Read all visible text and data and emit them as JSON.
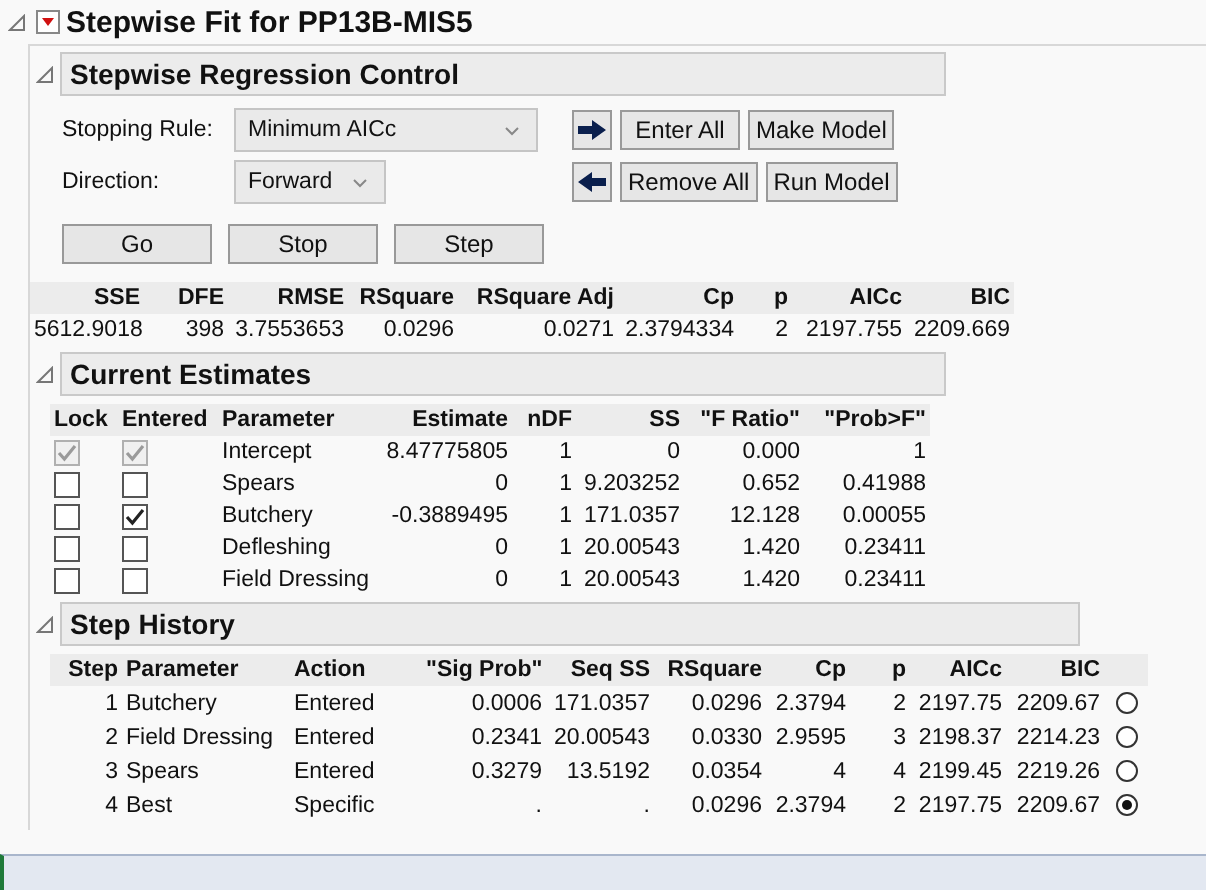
{
  "report": {
    "title": "Stepwise Fit for PP13B-MIS5",
    "expanded": true
  },
  "control": {
    "title": "Stepwise Regression Control",
    "expanded": true,
    "stopping_rule": {
      "label": "Stopping Rule:",
      "value": "Minimum AICc"
    },
    "direction": {
      "label": "Direction:",
      "value": "Forward"
    },
    "run_buttons": [
      "Go",
      "Stop",
      "Step"
    ],
    "enter_buttons": [
      "Enter All",
      "Make Model"
    ],
    "remove_buttons": [
      "Remove All",
      "Run Model"
    ]
  },
  "summary": {
    "columns": [
      "SSE",
      "DFE",
      "RMSE",
      "RSquare",
      "RSquare Adj",
      "Cp",
      "p",
      "AICc",
      "BIC"
    ],
    "row": [
      "5612.9018",
      "398",
      "3.7553653",
      "0.0296",
      "0.0271",
      "2.3794334",
      "2",
      "2197.755",
      "2209.669"
    ]
  },
  "estimates": {
    "title": "Current Estimates",
    "expanded": true,
    "checkbox_columns": [
      "Lock",
      "Entered"
    ],
    "columns": [
      "Parameter",
      "Estimate",
      "nDF",
      "SS",
      "\"F Ratio\"",
      "\"Prob>F\""
    ],
    "rows": [
      {
        "lock": {
          "checked": true,
          "disabled": true
        },
        "entered": {
          "checked": true,
          "disabled": true
        },
        "cells": [
          "Intercept",
          "8.47775805",
          "1",
          "0",
          "0.000",
          "1"
        ]
      },
      {
        "lock": {
          "checked": false,
          "disabled": false
        },
        "entered": {
          "checked": false,
          "disabled": false
        },
        "cells": [
          "Spears",
          "0",
          "1",
          "9.203252",
          "0.652",
          "0.41988"
        ]
      },
      {
        "lock": {
          "checked": false,
          "disabled": false
        },
        "entered": {
          "checked": true,
          "disabled": false
        },
        "cells": [
          "Butchery",
          "-0.3889495",
          "1",
          "171.0357",
          "12.128",
          "0.00055"
        ]
      },
      {
        "lock": {
          "checked": false,
          "disabled": false
        },
        "entered": {
          "checked": false,
          "disabled": false
        },
        "cells": [
          "Defleshing",
          "0",
          "1",
          "20.00543",
          "1.420",
          "0.23411"
        ]
      },
      {
        "lock": {
          "checked": false,
          "disabled": false
        },
        "entered": {
          "checked": false,
          "disabled": false
        },
        "cells": [
          "Field Dressing",
          "0",
          "1",
          "20.00543",
          "1.420",
          "0.23411"
        ]
      }
    ]
  },
  "history": {
    "title": "Step History",
    "expanded": true,
    "columns": [
      "Step",
      "Parameter",
      "Action",
      "\"Sig Prob\"",
      "Seq SS",
      "RSquare",
      "Cp",
      "p",
      "AICc",
      "BIC"
    ],
    "rows": [
      {
        "selected": false,
        "cells": [
          "1",
          "Butchery",
          "Entered",
          "0.0006",
          "171.0357",
          "0.0296",
          "2.3794",
          "2",
          "2197.75",
          "2209.67"
        ]
      },
      {
        "selected": false,
        "cells": [
          "2",
          "Field Dressing",
          "Entered",
          "0.2341",
          "20.00543",
          "0.0330",
          "2.9595",
          "3",
          "2198.37",
          "2214.23"
        ]
      },
      {
        "selected": false,
        "cells": [
          "3",
          "Spears",
          "Entered",
          "0.3279",
          "13.5192",
          "0.0354",
          "4",
          "4",
          "2199.45",
          "2219.26"
        ]
      },
      {
        "selected": true,
        "cells": [
          "4",
          "Best",
          "Specific",
          ".",
          ".",
          "0.0296",
          "2.3794",
          "2",
          "2197.75",
          "2209.67"
        ]
      }
    ]
  }
}
